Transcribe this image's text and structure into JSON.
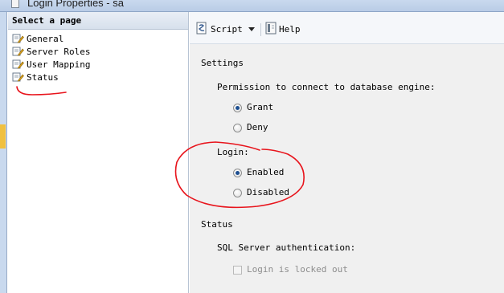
{
  "window": {
    "title": "Login Properties - sa"
  },
  "left_panel": {
    "header": "Select a page",
    "pages": [
      {
        "label": "General",
        "icon": "page-wrench-icon"
      },
      {
        "label": "Server Roles",
        "icon": "page-wrench-icon"
      },
      {
        "label": "User Mapping",
        "icon": "page-wrench-icon"
      },
      {
        "label": "Status",
        "icon": "page-wrench-icon"
      }
    ]
  },
  "toolbar": {
    "script_label": "Script",
    "help_label": "Help",
    "script_icon": "script-icon",
    "help_icon": "help-icon"
  },
  "settings": {
    "section_title": "Settings",
    "permission_label": "Permission to connect to database engine:",
    "grant_label": "Grant",
    "deny_label": "Deny",
    "permission_selected": "Grant",
    "login_label": "Login:",
    "enabled_label": "Enabled",
    "disabled_label": "Disabled",
    "login_selected": "Enabled"
  },
  "status": {
    "section_title": "Status",
    "auth_label": "SQL Server authentication:",
    "locked_out_label": "Login is locked out",
    "locked_out_checked": false
  },
  "colors": {
    "annotation": "#e8141c",
    "radio_dot": "#1d4f91",
    "header_bg": "#dde5f0"
  }
}
